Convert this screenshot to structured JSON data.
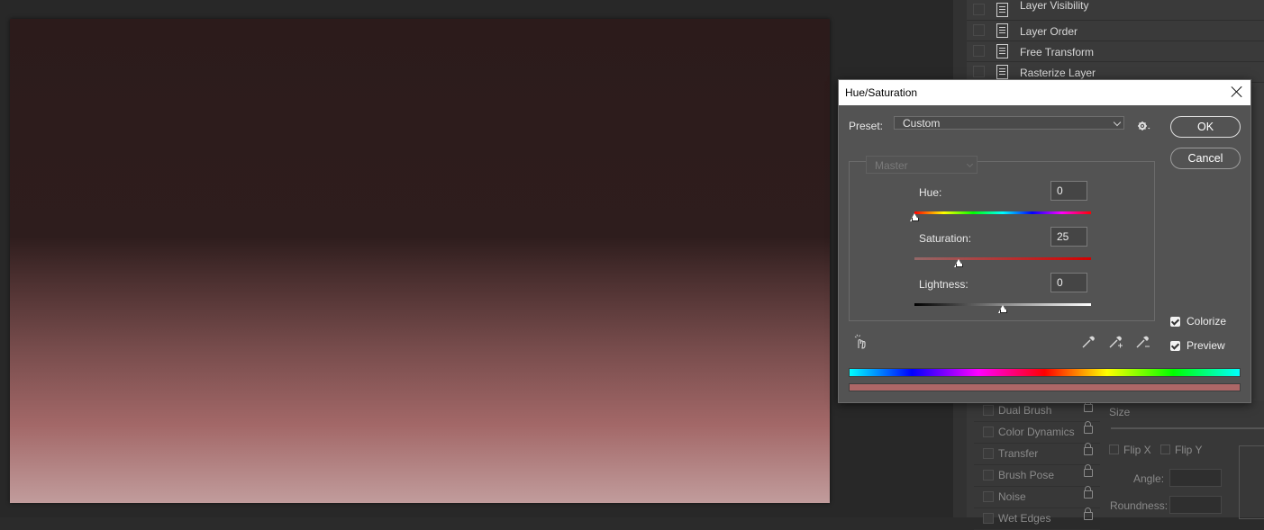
{
  "actions_panel": {
    "items": [
      {
        "label": "Layer Visibility"
      },
      {
        "label": "Layer Order"
      },
      {
        "label": "Free Transform"
      },
      {
        "label": "Rasterize Layer"
      }
    ]
  },
  "brush_panel": {
    "items": [
      {
        "label": "Dual Brush"
      },
      {
        "label": "Color Dynamics"
      },
      {
        "label": "Transfer"
      },
      {
        "label": "Brush Pose"
      },
      {
        "label": "Noise"
      },
      {
        "label": "Wet Edges"
      }
    ],
    "size_label": "Size",
    "flip_x_label": "Flip X",
    "flip_y_label": "Flip Y",
    "angle_label": "Angle:",
    "roundness_label": "Roundness:"
  },
  "dialog": {
    "title": "Hue/Saturation",
    "preset_label": "Preset:",
    "preset_value": "Custom",
    "ok_label": "OK",
    "cancel_label": "Cancel",
    "channel_value": "Master",
    "hue": {
      "label": "Hue:",
      "value": "0",
      "position": 0.0
    },
    "saturation": {
      "label": "Saturation:",
      "value": "25",
      "position": 0.25
    },
    "lightness": {
      "label": "Lightness:",
      "value": "0",
      "position": 0.5
    },
    "colorize": {
      "label": "Colorize",
      "checked": true
    },
    "preview": {
      "label": "Preview",
      "checked": true
    },
    "colorized_swatch": "#ad6767"
  },
  "colors": {
    "canvas_top": "#2c1b1b",
    "canvas_bottom": "#c19c9c",
    "dialog_bg": "#535353"
  }
}
